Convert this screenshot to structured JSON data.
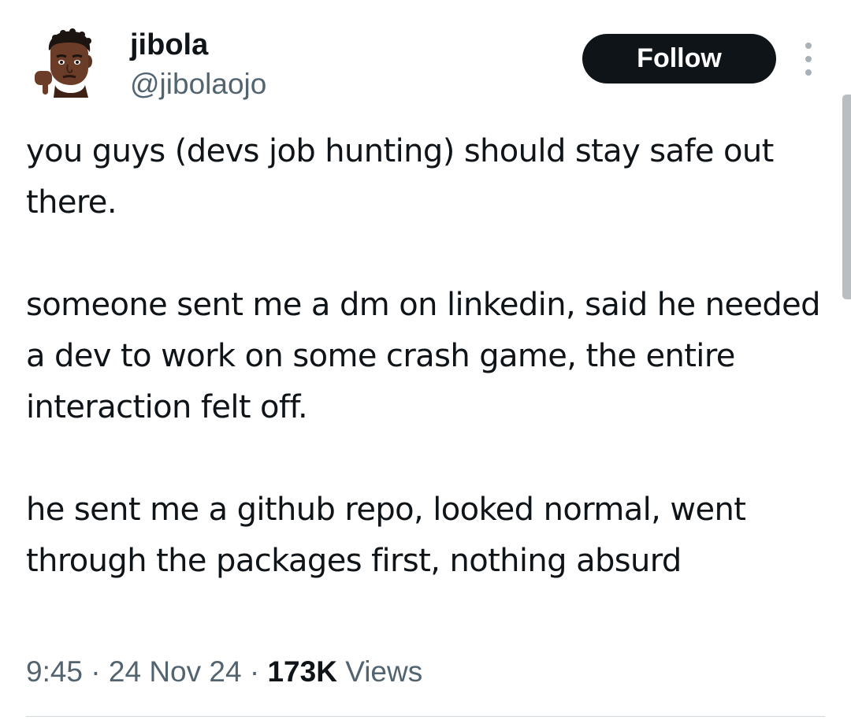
{
  "author": {
    "display_name": "jibola",
    "handle": "@jibolaojo",
    "avatar_icon": "memoji-thumbs-down-avatar"
  },
  "actions": {
    "follow_label": "Follow",
    "more_icon": "more-vertical-icon"
  },
  "tweet": {
    "paragraphs": [
      "you guys (devs job hunting) should stay safe out there.",
      "someone sent me a dm on linkedin, said he needed a dev to work on some crash game, the entire interaction felt off.",
      "he sent me a github repo, looked normal, went through the packages first, nothing absurd"
    ],
    "time": "9:45",
    "separator": "·",
    "date": "24 Nov 24",
    "views_count": "173K",
    "views_label": "Views"
  },
  "colors": {
    "text": "#0f1419",
    "secondary_text": "#536471",
    "button_bg": "#0f1419",
    "divider": "#cfd9de"
  }
}
